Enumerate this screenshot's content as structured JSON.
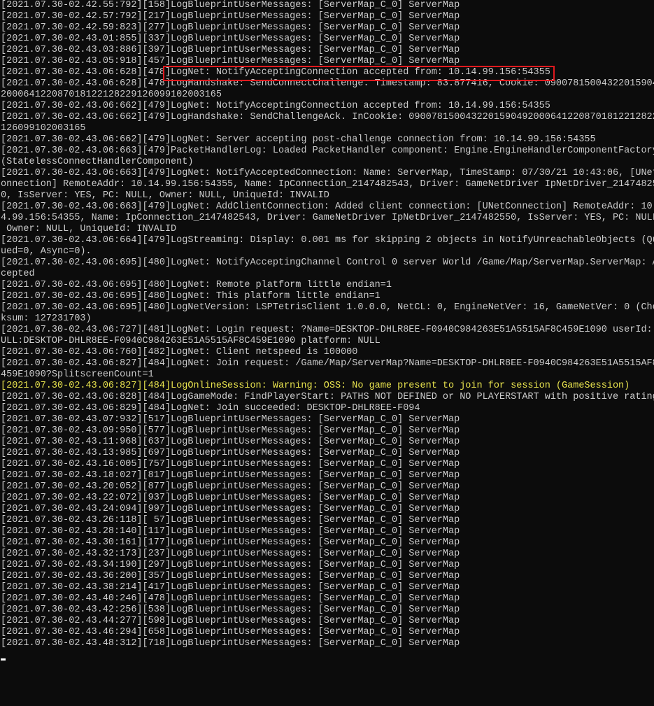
{
  "console": {
    "lines": [
      {
        "text": "[2021.07.30-02.42.55:792][158]LogBlueprintUserMessages: [ServerMap_C_0] ServerMap",
        "level": "normal"
      },
      {
        "text": "[2021.07.30-02.42.57:792][217]LogBlueprintUserMessages: [ServerMap_C_0] ServerMap",
        "level": "normal"
      },
      {
        "text": "[2021.07.30-02.42.59:823][277]LogBlueprintUserMessages: [ServerMap_C_0] ServerMap",
        "level": "normal"
      },
      {
        "text": "[2021.07.30-02.43.01:855][337]LogBlueprintUserMessages: [ServerMap_C_0] ServerMap",
        "level": "normal"
      },
      {
        "text": "[2021.07.30-02.43.03:886][397]LogBlueprintUserMessages: [ServerMap_C_0] ServerMap",
        "level": "normal"
      },
      {
        "text": "[2021.07.30-02.43.05:918][457]LogBlueprintUserMessages: [ServerMap_C_0] ServerMap",
        "level": "normal"
      },
      {
        "text": "[2021.07.30-02.43.06:628][478]LogNet: NotifyAcceptingConnection accepted from: 10.14.99.156:54355",
        "level": "normal"
      },
      {
        "text": "[2021.07.30-02.43.06:628][478]LogHandshake: SendConnectChallenge. Timestamp: 83.877416, Cookie: 090078150043220159049",
        "level": "normal"
      },
      {
        "text": "200064122087018122128229126099102003165",
        "level": "normal"
      },
      {
        "text": "[2021.07.30-02.43.06:662][479]LogNet: NotifyAcceptingConnection accepted from: 10.14.99.156:54355",
        "level": "normal"
      },
      {
        "text": "[2021.07.30-02.43.06:662][479]LogHandshake: SendChallengeAck. InCookie: 090078150043220159049200064122087018122128229",
        "level": "normal"
      },
      {
        "text": "126099102003165",
        "level": "normal"
      },
      {
        "text": "[2021.07.30-02.43.06:662][479]LogNet: Server accepting post-challenge connection from: 10.14.99.156:54355",
        "level": "normal"
      },
      {
        "text": "[2021.07.30-02.43.06:663][479]PacketHandlerLog: Loaded PacketHandler component: Engine.EngineHandlerComponentFactory",
        "level": "normal"
      },
      {
        "text": "(StatelessConnectHandlerComponent)",
        "level": "normal"
      },
      {
        "text": "[2021.07.30-02.43.06:663][479]LogNet: NotifyAcceptedConnection: Name: ServerMap, TimeStamp: 07/30/21 10:43:06, [UNetC",
        "level": "normal"
      },
      {
        "text": "onnection] RemoteAddr: 10.14.99.156:54355, Name: IpConnection_2147482543, Driver: GameNetDriver IpNetDriver_214748255",
        "level": "normal"
      },
      {
        "text": "0, IsServer: YES, PC: NULL, Owner: NULL, UniqueId: INVALID",
        "level": "normal"
      },
      {
        "text": "[2021.07.30-02.43.06:663][479]LogNet: AddClientConnection: Added client connection: [UNetConnection] RemoteAddr: 10.1",
        "level": "normal"
      },
      {
        "text": "4.99.156:54355, Name: IpConnection_2147482543, Driver: GameNetDriver IpNetDriver_2147482550, IsServer: YES, PC: NULL,",
        "level": "normal"
      },
      {
        "text": " Owner: NULL, UniqueId: INVALID",
        "level": "normal"
      },
      {
        "text": "[2021.07.30-02.43.06:664][479]LogStreaming: Display: 0.001 ms for skipping 2 objects in NotifyUnreachableObjects (Que",
        "level": "normal"
      },
      {
        "text": "ued=0, Async=0).",
        "level": "normal"
      },
      {
        "text": "[2021.07.30-02.43.06:695][480]LogNet: NotifyAcceptingChannel Control 0 server World /Game/Map/ServerMap.ServerMap: Ac",
        "level": "normal"
      },
      {
        "text": "cepted",
        "level": "normal"
      },
      {
        "text": "[2021.07.30-02.43.06:695][480]LogNet: Remote platform little endian=1",
        "level": "normal"
      },
      {
        "text": "[2021.07.30-02.43.06:695][480]LogNet: This platform little endian=1",
        "level": "normal"
      },
      {
        "text": "[2021.07.30-02.43.06:695][480]LogNetVersion: LSPTetrisClient 1.0.0.0, NetCL: 0, EngineNetVer: 16, GameNetVer: 0 (Chec",
        "level": "normal"
      },
      {
        "text": "ksum: 127231703)",
        "level": "normal"
      },
      {
        "text": "[2021.07.30-02.43.06:727][481]LogNet: Login request: ?Name=DESKTOP-DHLR8EE-F0940C984263E51A5515AF8C459E1090 userId: N",
        "level": "normal"
      },
      {
        "text": "ULL:DESKTOP-DHLR8EE-F0940C984263E51A5515AF8C459E1090 platform: NULL",
        "level": "normal"
      },
      {
        "text": "[2021.07.30-02.43.06:760][482]LogNet: Client netspeed is 100000",
        "level": "normal"
      },
      {
        "text": "[2021.07.30-02.43.06:827][484]LogNet: Join request: /Game/Map/ServerMap?Name=DESKTOP-DHLR8EE-F0940C984263E51A5515AF8C",
        "level": "normal"
      },
      {
        "text": "459E1090?SplitscreenCount=1",
        "level": "normal"
      },
      {
        "text": "[2021.07.30-02.43.06:827][484]LogOnlineSession: Warning: OSS: No game present to join for session (GameSession)",
        "level": "warning"
      },
      {
        "text": "[2021.07.30-02.43.06:828][484]LogGameMode: FindPlayerStart: PATHS NOT DEFINED or NO PLAYERSTART with positive rating",
        "level": "normal"
      },
      {
        "text": "[2021.07.30-02.43.06:829][484]LogNet: Join succeeded: DESKTOP-DHLR8EE-F094",
        "level": "normal"
      },
      {
        "text": "[2021.07.30-02.43.07:932][517]LogBlueprintUserMessages: [ServerMap_C_0] ServerMap",
        "level": "normal"
      },
      {
        "text": "[2021.07.30-02.43.09:950][577]LogBlueprintUserMessages: [ServerMap_C_0] ServerMap",
        "level": "normal"
      },
      {
        "text": "[2021.07.30-02.43.11:968][637]LogBlueprintUserMessages: [ServerMap_C_0] ServerMap",
        "level": "normal"
      },
      {
        "text": "[2021.07.30-02.43.13:985][697]LogBlueprintUserMessages: [ServerMap_C_0] ServerMap",
        "level": "normal"
      },
      {
        "text": "[2021.07.30-02.43.16:005][757]LogBlueprintUserMessages: [ServerMap_C_0] ServerMap",
        "level": "normal"
      },
      {
        "text": "[2021.07.30-02.43.18:027][817]LogBlueprintUserMessages: [ServerMap_C_0] ServerMap",
        "level": "normal"
      },
      {
        "text": "[2021.07.30-02.43.20:052][877]LogBlueprintUserMessages: [ServerMap_C_0] ServerMap",
        "level": "normal"
      },
      {
        "text": "[2021.07.30-02.43.22:072][937]LogBlueprintUserMessages: [ServerMap_C_0] ServerMap",
        "level": "normal"
      },
      {
        "text": "[2021.07.30-02.43.24:094][997]LogBlueprintUserMessages: [ServerMap_C_0] ServerMap",
        "level": "normal"
      },
      {
        "text": "[2021.07.30-02.43.26:118][ 57]LogBlueprintUserMessages: [ServerMap_C_0] ServerMap",
        "level": "normal"
      },
      {
        "text": "[2021.07.30-02.43.28:140][117]LogBlueprintUserMessages: [ServerMap_C_0] ServerMap",
        "level": "normal"
      },
      {
        "text": "[2021.07.30-02.43.30:161][177]LogBlueprintUserMessages: [ServerMap_C_0] ServerMap",
        "level": "normal"
      },
      {
        "text": "[2021.07.30-02.43.32:173][237]LogBlueprintUserMessages: [ServerMap_C_0] ServerMap",
        "level": "normal"
      },
      {
        "text": "[2021.07.30-02.43.34:190][297]LogBlueprintUserMessages: [ServerMap_C_0] ServerMap",
        "level": "normal"
      },
      {
        "text": "[2021.07.30-02.43.36:200][357]LogBlueprintUserMessages: [ServerMap_C_0] ServerMap",
        "level": "normal"
      },
      {
        "text": "[2021.07.30-02.43.38:214][417]LogBlueprintUserMessages: [ServerMap_C_0] ServerMap",
        "level": "normal"
      },
      {
        "text": "[2021.07.30-02.43.40:246][478]LogBlueprintUserMessages: [ServerMap_C_0] ServerMap",
        "level": "normal"
      },
      {
        "text": "[2021.07.30-02.43.42:256][538]LogBlueprintUserMessages: [ServerMap_C_0] ServerMap",
        "level": "normal"
      },
      {
        "text": "[2021.07.30-02.43.44:277][598]LogBlueprintUserMessages: [ServerMap_C_0] ServerMap",
        "level": "normal"
      },
      {
        "text": "[2021.07.30-02.43.46:294][658]LogBlueprintUserMessages: [ServerMap_C_0] ServerMap",
        "level": "normal"
      },
      {
        "text": "[2021.07.30-02.43.48:312][718]LogBlueprintUserMessages: [ServerMap_C_0] ServerMap",
        "level": "normal"
      }
    ],
    "colors": {
      "background": "#0c0c0c",
      "text": "#cccccc",
      "warning": "#e8e34e",
      "highlight_box": "#e0191e",
      "cursor": "#ffffff"
    }
  }
}
